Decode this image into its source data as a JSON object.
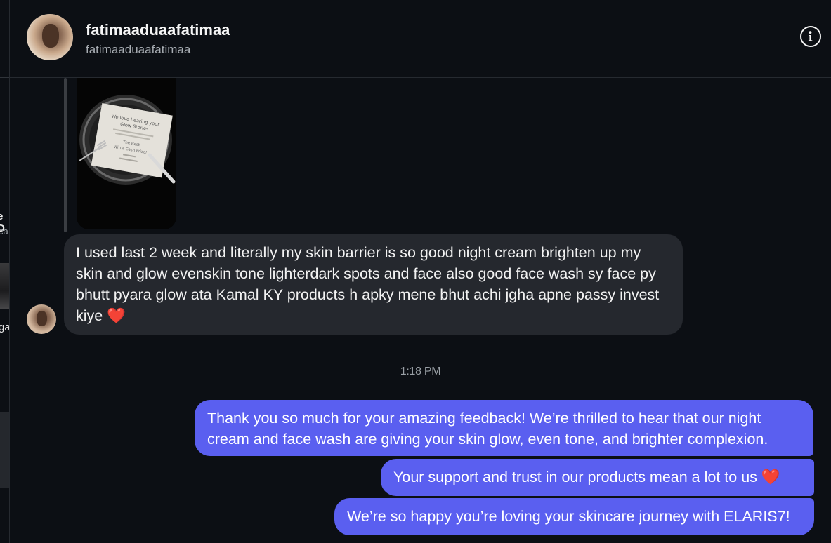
{
  "left_panel": {
    "fragment_name": "e D",
    "fragment_sub": "ca",
    "fragment_text": "ga"
  },
  "header": {
    "title": "fatimaaduaafatimaa",
    "username": "fatimaaduaafatimaa",
    "info_icon": "info-icon"
  },
  "shared_card": {
    "line1": "We love hearing your",
    "line2": "Glow Stories",
    "line3": "The Best",
    "line4": "Win a Cash Prize!"
  },
  "messages": {
    "incoming_1": "I used last 2 week and literally my skin barrier is so good night cream brighten up my skin and glow evenskin tone lighterdark spots and face also good face wash sy face py bhutt pyara glow ata Kamal KY products h apky mene bhut achi jgha apne passy invest kiye",
    "heart": "❤️",
    "timestamp": "1:18 PM",
    "outgoing_1": "Thank you so much for your amazing feedback! We’re thrilled to hear that our night cream and face wash are giving your skin glow, even tone, and brighter complexion.",
    "outgoing_2": "Your support and trust in our products mean a lot to us",
    "outgoing_3": "We’re so happy you’re loving your skincare journey with ELARIS7!"
  },
  "colors": {
    "background": "#0c0f14",
    "incoming_bubble": "#25282e",
    "outgoing_bubble": "#5a5ff0"
  }
}
